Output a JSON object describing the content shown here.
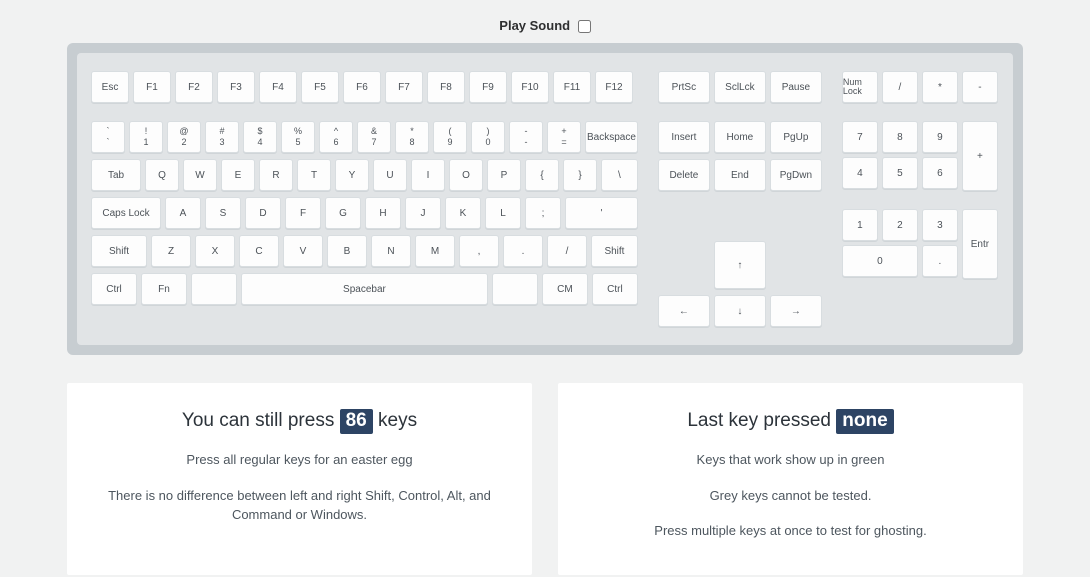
{
  "topbar": {
    "label": "Play Sound"
  },
  "main": {
    "row0": [
      "Esc",
      "F1",
      "F2",
      "F3",
      "F4",
      "F5",
      "F6",
      "F7",
      "F8",
      "F9",
      "F10",
      "F11",
      "F12"
    ],
    "row1": [
      {
        "t": "`",
        "b": "`"
      },
      {
        "t": "!",
        "b": "1"
      },
      {
        "t": "@",
        "b": "2"
      },
      {
        "t": "#",
        "b": "3"
      },
      {
        "t": "$",
        "b": "4"
      },
      {
        "t": "%",
        "b": "5"
      },
      {
        "t": "^",
        "b": "6"
      },
      {
        "t": "&",
        "b": "7"
      },
      {
        "t": "*",
        "b": "8"
      },
      {
        "t": "(",
        "b": "9"
      },
      {
        "t": ")",
        "b": "0"
      },
      {
        "t": "-",
        "b": "-"
      },
      {
        "t": "+",
        "b": "="
      }
    ],
    "backspace": "Backspace",
    "row2_lead": "Tab",
    "row2": [
      "Q",
      "W",
      "E",
      "R",
      "T",
      "Y",
      "U",
      "I",
      "O",
      "P",
      "{",
      "}",
      "\\"
    ],
    "row3_lead": "Caps Lock",
    "row3": [
      "A",
      "S",
      "D",
      "F",
      "G",
      "H",
      "J",
      "K",
      "L",
      ";",
      "'"
    ],
    "row4_lead": "Shift",
    "row4": [
      "Z",
      "X",
      "C",
      "V",
      "B",
      "N",
      "M",
      ",",
      ".",
      "/"
    ],
    "row4_tail": "Shift",
    "row5": [
      "Ctrl",
      "Fn",
      "",
      "Spacebar",
      "",
      "CM",
      "Ctrl"
    ]
  },
  "nav": {
    "r0": [
      "PrtSc",
      "SclLck",
      "Pause"
    ],
    "r1": [
      "Insert",
      "Home",
      "PgUp"
    ],
    "r2": [
      "Delete",
      "End",
      "PgDwn"
    ],
    "arrows": {
      "up": "↑",
      "left": "←",
      "down": "↓",
      "right": "→"
    }
  },
  "numpad": {
    "r0": [
      "Num Lock",
      "/",
      "*",
      "-"
    ],
    "r1": [
      "7",
      "8",
      "9"
    ],
    "r2": [
      "4",
      "5",
      "6"
    ],
    "plus": "+",
    "r3": [
      "1",
      "2",
      "3"
    ],
    "r4_zero": "0",
    "r4_dot": ".",
    "enter": "Entr"
  },
  "cards": {
    "left": {
      "title_pre": "You can still press ",
      "count": "86",
      "title_post": " keys",
      "line1": "Press all regular keys for an easter egg",
      "line2": "There is no difference between left and right Shift, Control, Alt, and Command or Windows."
    },
    "right": {
      "title_pre": "Last key pressed ",
      "value": "none",
      "line1": "Keys that work show up in green",
      "line2": "Grey keys cannot be tested.",
      "line3": "Press multiple keys at once to test for ghosting."
    }
  }
}
